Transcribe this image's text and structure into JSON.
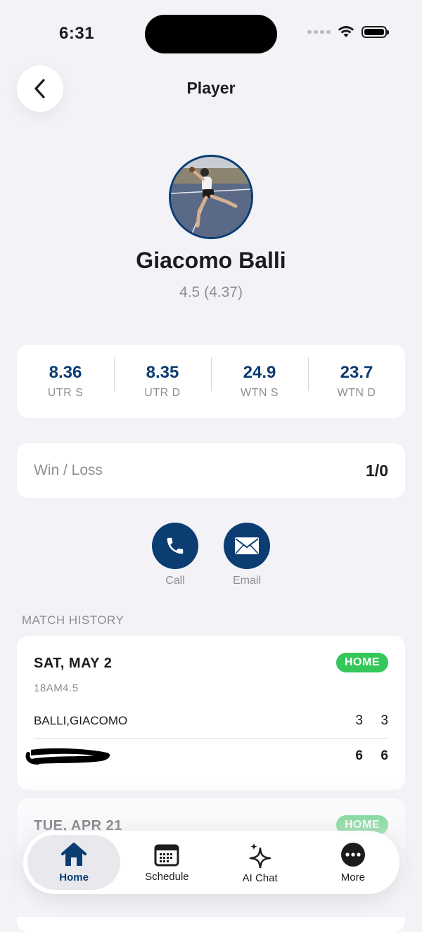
{
  "status_bar": {
    "time": "6:31"
  },
  "header": {
    "title": "Player"
  },
  "player": {
    "name": "Giacomo Balli",
    "rating": "4.5 (4.37)"
  },
  "stats": [
    {
      "value": "8.36",
      "label": "UTR S"
    },
    {
      "value": "8.35",
      "label": "UTR D"
    },
    {
      "value": "24.9",
      "label": "WTN S"
    },
    {
      "value": "23.7",
      "label": "WTN D"
    }
  ],
  "win_loss": {
    "label": "Win / Loss",
    "value": "1/0"
  },
  "contact": {
    "call_label": "Call",
    "email_label": "Email"
  },
  "match_history": {
    "title": "MATCH HISTORY",
    "matches": [
      {
        "date": "SAT, MAY 2",
        "badge": "HOME",
        "league": "18AM4.5",
        "player1": {
          "name": "BALLI,GIACOMO",
          "set1": "3",
          "set2": "3"
        },
        "player2": {
          "name": "",
          "set1": "6",
          "set2": "6"
        }
      },
      {
        "date": "TUE, APR 21",
        "badge": "HOME"
      }
    ]
  },
  "tabbar": {
    "tabs": [
      {
        "label": "Home",
        "icon": "home-icon",
        "active": true
      },
      {
        "label": "Schedule",
        "icon": "calendar-icon"
      },
      {
        "label": "AI Chat",
        "icon": "sparkles-icon"
      },
      {
        "label": "More",
        "icon": "more-icon"
      }
    ]
  },
  "colors": {
    "accent": "#0b3d73",
    "home_badge": "#34c759",
    "background": "#f2f2f7"
  }
}
